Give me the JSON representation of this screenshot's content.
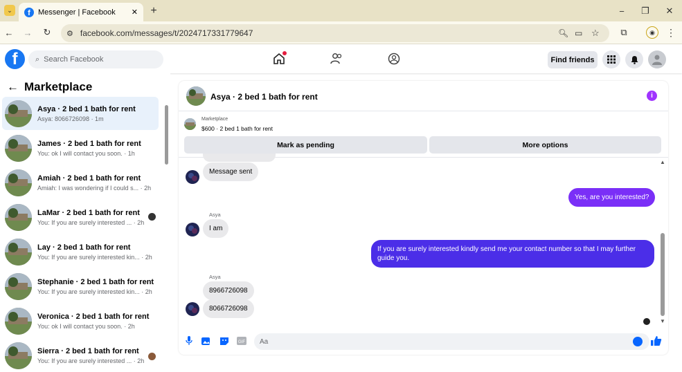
{
  "browser": {
    "tab_title": "Messenger | Facebook",
    "url": "facebook.com/messages/t/2024717331779647",
    "new_tab": "+",
    "win_min": "−",
    "win_max": "❐",
    "win_close": "✕",
    "tab_close": "✕",
    "back": "←",
    "forward": "→",
    "reload": "↻",
    "menu": "⋮"
  },
  "header": {
    "logo": "f",
    "search_placeholder": "Search Facebook",
    "find_friends": "Find friends"
  },
  "sidebar": {
    "title": "Marketplace",
    "back": "←",
    "conversations": [
      {
        "name": "Asya · 2 bed 1 bath for rent",
        "preview": "Asya: 8066726098 · 1m",
        "active": true
      },
      {
        "name": "James · 2 bed 1 bath for rent",
        "preview": "You: ok I will contact you soon. · 1h"
      },
      {
        "name": "Amiah · 2 bed 1 bath for rent",
        "preview": "Amiah: I was wondering if I could s... · 2h"
      },
      {
        "name": "LaMar · 2 bed 1 bath for rent",
        "preview": "You: If you are surely interested ... · 2h"
      },
      {
        "name": "Lay · 2 bed 1 bath for rent",
        "preview": "You: If you are surely interested kin... · 2h"
      },
      {
        "name": "Stephanie · 2 bed 1 bath for rent",
        "preview": "You: If you are surely interested kin... · 2h"
      },
      {
        "name": "Veronica · 2 bed 1 bath for rent",
        "preview": "You: ok I will contact you soon. · 2h"
      },
      {
        "name": "Sierra · 2 bed 1 bath for rent",
        "preview": "You: If you are surely interested ... · 2h"
      }
    ]
  },
  "chat": {
    "title": "Asya · 2 bed 1 bath for rent",
    "info": "i",
    "listing_category": "Marketplace",
    "listing_desc": "$600 · 2 bed 1 bath for rent",
    "mark_pending": "Mark as pending",
    "more_options": "More options",
    "messages": {
      "m1": "Message sent",
      "m2": "Yes, are you interested?",
      "m3_sender": "Asya",
      "m3": "I am",
      "m4": "If you are surely interested kindly send me your contact number so that I may further guide you.",
      "m5_sender": "Asya",
      "m5": "8966726098",
      "m6": "8066726098"
    },
    "input_placeholder": "Aa"
  }
}
